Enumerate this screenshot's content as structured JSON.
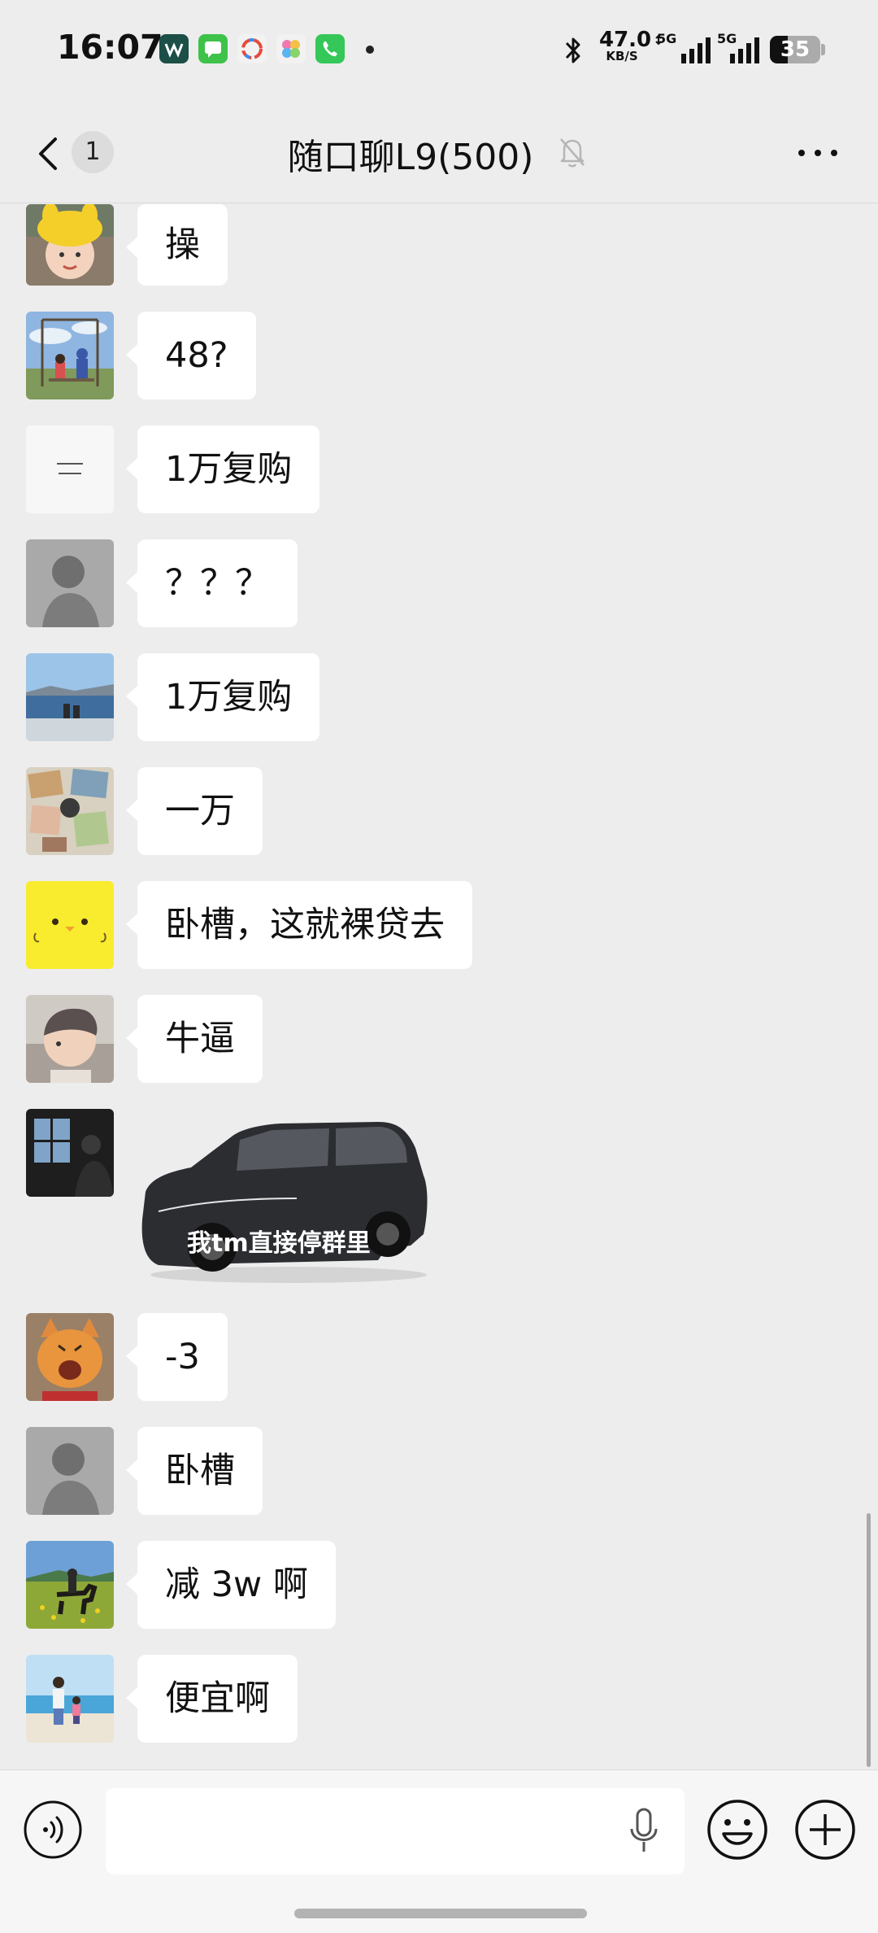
{
  "status_bar": {
    "time": "16:07",
    "app_icons": [
      {
        "name": "wps-icon",
        "color": "#1b4f47"
      },
      {
        "name": "messages-icon",
        "color": "#3ec24a"
      },
      {
        "name": "photos-icon",
        "color": "#f2f2f2"
      },
      {
        "name": "gallery-icon",
        "color": "#f2f2f2"
      },
      {
        "name": "phone-icon",
        "color": "#35c758"
      }
    ],
    "net_speed_value": "47.0",
    "net_speed_unit": "KB/S",
    "signal_1_label": "5G",
    "signal_2_label": "5G",
    "battery_level": "35",
    "battery_fraction": 0.35
  },
  "nav": {
    "unread_count": "1",
    "title": "随口聊L9(500)"
  },
  "messages": [
    {
      "avatar": "avatar-yellow-hat-child",
      "text": "操"
    },
    {
      "avatar": "avatar-swing-sky",
      "text": "48?"
    },
    {
      "avatar": "avatar-white-text",
      "text": "1万复购"
    },
    {
      "avatar": "avatar-gray-portrait",
      "text": "？？？"
    },
    {
      "avatar": "avatar-lake-view",
      "text": "1万复购"
    },
    {
      "avatar": "avatar-collage",
      "text": "一万"
    },
    {
      "avatar": "avatar-yellow-chick",
      "text": "卧槽，这就裸贷去"
    },
    {
      "avatar": "avatar-child-haircut",
      "text": "牛逼"
    },
    {
      "avatar": "avatar-window-dark",
      "sticker_caption": "我tm直接停群里"
    },
    {
      "avatar": "avatar-orange-cat",
      "text": "-3"
    },
    {
      "avatar": "avatar-gray-portrait",
      "text": "卧槽"
    },
    {
      "avatar": "avatar-horse-field",
      "text": "减 3w 啊"
    },
    {
      "avatar": "avatar-beach-family",
      "text": "便宜啊"
    }
  ],
  "colors": {
    "background": "#ededed",
    "bubble": "#ffffff",
    "input_bar": "#f6f6f6"
  }
}
